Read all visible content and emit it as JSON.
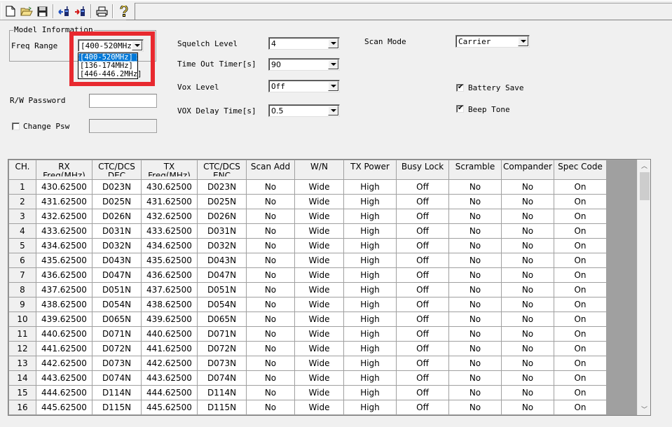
{
  "toolbar": {
    "buttons": [
      {
        "name": "new-file-icon"
      },
      {
        "name": "open-folder-icon"
      },
      {
        "name": "save-icon"
      },
      {
        "name": "read-from-radio-icon"
      },
      {
        "name": "write-to-radio-icon"
      },
      {
        "name": "print-icon"
      },
      {
        "name": "help-icon"
      }
    ]
  },
  "model_info": {
    "group_title": "Model Information",
    "freq_range_label": "Freq Range",
    "freq_range_value": "[400-520MHz]",
    "freq_range_options": [
      "[400-520MHz]",
      "[136-174MHz]",
      "[446-446.2MHz]"
    ],
    "freq_range_selected_index": 0
  },
  "password": {
    "rw_password_label": "R/W Password",
    "rw_password_value": "",
    "change_psw_label": "Change Psw",
    "change_psw_checked": false,
    "change_psw_value": ""
  },
  "settings": {
    "squelch_level": {
      "label": "Squelch Level",
      "value": "4"
    },
    "time_out_timer": {
      "label": "Time Out Timer[s]",
      "value": "90"
    },
    "vox_level": {
      "label": "Vox Level",
      "value": "Off"
    },
    "vox_delay_time": {
      "label": "VOX Delay Time[s]",
      "value": "0.5"
    },
    "scan_mode": {
      "label": "Scan Mode",
      "value": "Carrier"
    },
    "battery_save": {
      "label": "Battery Save",
      "checked": true
    },
    "beep_tone": {
      "label": "Beep Tone",
      "checked": true
    }
  },
  "channel_table": {
    "headers": [
      {
        "top": "CH.",
        "sub": ""
      },
      {
        "top": "RX",
        "sub": "Freq(MHz)"
      },
      {
        "top": "CTC/DCS",
        "sub": "DEC"
      },
      {
        "top": "TX",
        "sub": "Freq(MHz)"
      },
      {
        "top": "CTC/DCS",
        "sub": "ENC"
      },
      {
        "top": "Scan Add",
        "sub": ""
      },
      {
        "top": "W/N",
        "sub": ""
      },
      {
        "top": "TX Power",
        "sub": ""
      },
      {
        "top": "Busy Lock",
        "sub": ""
      },
      {
        "top": "Scramble",
        "sub": ""
      },
      {
        "top": "Compander",
        "sub": ""
      },
      {
        "top": "Spec Code",
        "sub": ""
      }
    ],
    "rows": [
      [
        "1",
        "430.62500",
        "D023N",
        "430.62500",
        "D023N",
        "No",
        "Wide",
        "High",
        "Off",
        "No",
        "No",
        "On"
      ],
      [
        "2",
        "431.62500",
        "D025N",
        "431.62500",
        "D025N",
        "No",
        "Wide",
        "High",
        "Off",
        "No",
        "No",
        "On"
      ],
      [
        "3",
        "432.62500",
        "D026N",
        "432.62500",
        "D026N",
        "No",
        "Wide",
        "High",
        "Off",
        "No",
        "No",
        "On"
      ],
      [
        "4",
        "433.62500",
        "D031N",
        "433.62500",
        "D031N",
        "No",
        "Wide",
        "High",
        "Off",
        "No",
        "No",
        "On"
      ],
      [
        "5",
        "434.62500",
        "D032N",
        "434.62500",
        "D032N",
        "No",
        "Wide",
        "High",
        "Off",
        "No",
        "No",
        "On"
      ],
      [
        "6",
        "435.62500",
        "D043N",
        "435.62500",
        "D043N",
        "No",
        "Wide",
        "High",
        "Off",
        "No",
        "No",
        "On"
      ],
      [
        "7",
        "436.62500",
        "D047N",
        "436.62500",
        "D047N",
        "No",
        "Wide",
        "High",
        "Off",
        "No",
        "No",
        "On"
      ],
      [
        "8",
        "437.62500",
        "D051N",
        "437.62500",
        "D051N",
        "No",
        "Wide",
        "High",
        "Off",
        "No",
        "No",
        "On"
      ],
      [
        "9",
        "438.62500",
        "D054N",
        "438.62500",
        "D054N",
        "No",
        "Wide",
        "High",
        "Off",
        "No",
        "No",
        "On"
      ],
      [
        "10",
        "439.62500",
        "D065N",
        "439.62500",
        "D065N",
        "No",
        "Wide",
        "High",
        "Off",
        "No",
        "No",
        "On"
      ],
      [
        "11",
        "440.62500",
        "D071N",
        "440.62500",
        "D071N",
        "No",
        "Wide",
        "High",
        "Off",
        "No",
        "No",
        "On"
      ],
      [
        "12",
        "441.62500",
        "D072N",
        "441.62500",
        "D072N",
        "No",
        "Wide",
        "High",
        "Off",
        "No",
        "No",
        "On"
      ],
      [
        "13",
        "442.62500",
        "D073N",
        "442.62500",
        "D073N",
        "No",
        "Wide",
        "High",
        "Off",
        "No",
        "No",
        "On"
      ],
      [
        "14",
        "443.62500",
        "D074N",
        "443.62500",
        "D074N",
        "No",
        "Wide",
        "High",
        "Off",
        "No",
        "No",
        "On"
      ],
      [
        "15",
        "444.62500",
        "D114N",
        "444.62500",
        "D114N",
        "No",
        "Wide",
        "High",
        "Off",
        "No",
        "No",
        "On"
      ],
      [
        "16",
        "445.62500",
        "D115N",
        "445.62500",
        "D115N",
        "No",
        "Wide",
        "High",
        "Off",
        "No",
        "No",
        "On"
      ]
    ]
  },
  "colors": {
    "highlight": "#e8292f",
    "selection": "#0078d7"
  }
}
